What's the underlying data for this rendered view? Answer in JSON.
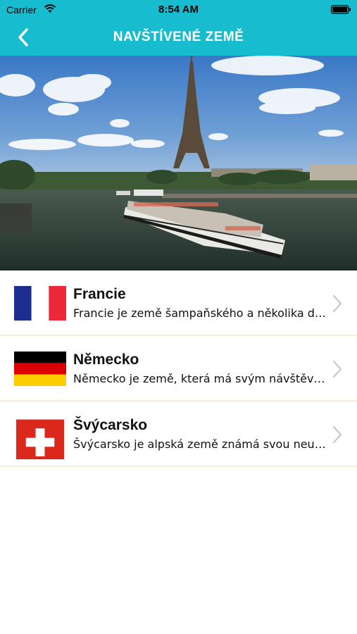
{
  "status_bar": {
    "carrier": "Carrier",
    "time": "8:54 AM"
  },
  "header": {
    "title": "NAVŠTÍVENÉ ZEMĚ",
    "accent_color": "#18bccf",
    "back_icon": "chevron-left-icon"
  },
  "hero": {
    "icon": "eiffel-tower-seine-photo"
  },
  "countries": [
    {
      "name": "Francie",
      "description": "Francie je země šampaňského a několika dalších vín",
      "flag_icon": "flag-france-icon"
    },
    {
      "name": "Německo",
      "description": "Německo je země, která má svým návštěvníkům co nabídnout",
      "flag_icon": "flag-germany-icon"
    },
    {
      "name": "Švýcarsko",
      "description": "Švýcarsko je alpská země známá svou neutralitou",
      "flag_icon": "flag-switzerland-icon"
    }
  ]
}
